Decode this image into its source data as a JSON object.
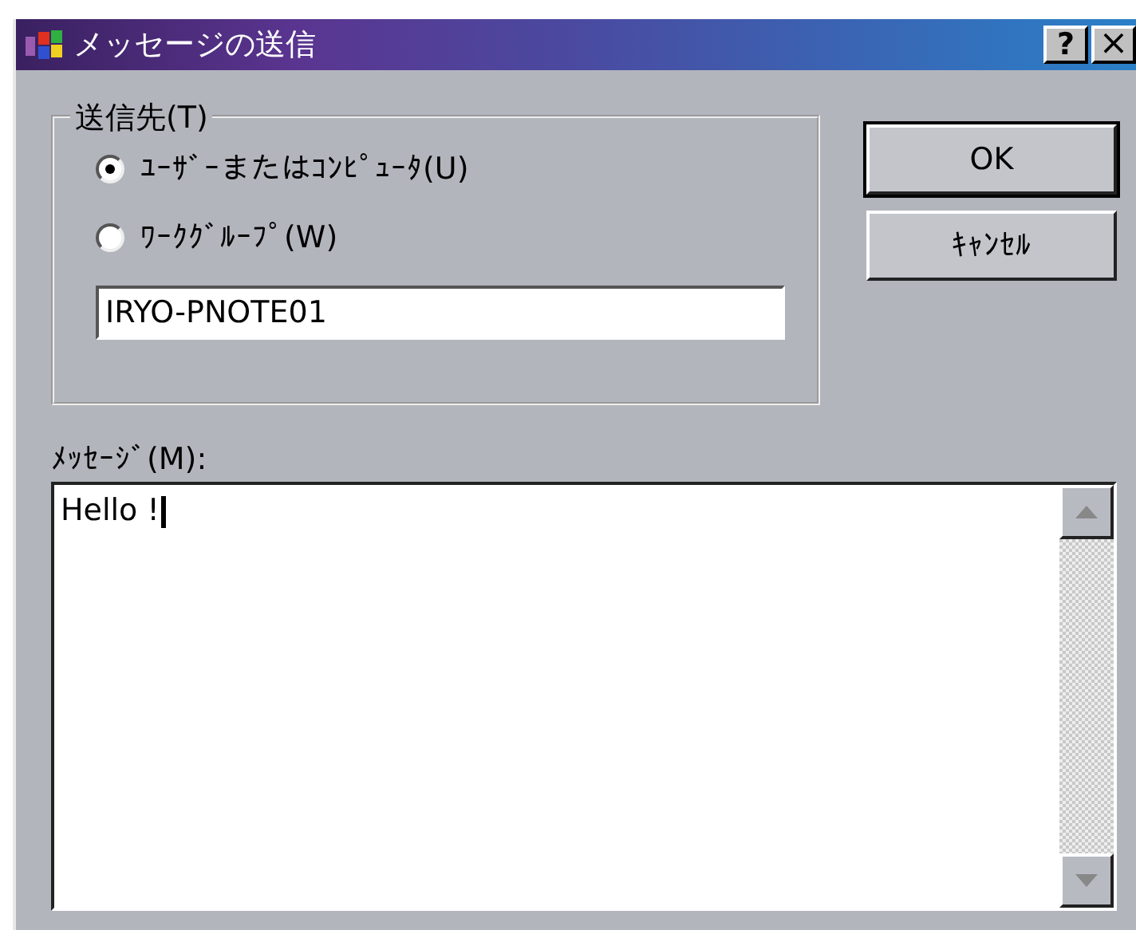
{
  "window": {
    "title": "メッセージの送信",
    "buttons": [
      {
        "kind": "help",
        "label": "?"
      },
      {
        "kind": "close",
        "label": "×"
      }
    ]
  },
  "destination": {
    "label": "送信先(T)",
    "options": [
      {
        "label": "ﾕｰｻﾞｰまたはｺﾝﾋﾟｭｰﾀ(U)",
        "selected": true
      },
      {
        "label": "ﾜｰｸｸﾞﾙｰﾌﾟ(W)",
        "selected": false
      }
    ],
    "name_field": {
      "value": "IRYO-PNOTE01"
    }
  },
  "buttons": [
    {
      "label": "OK",
      "default": true
    },
    {
      "label": "ｷｬﾝｾﾙ",
      "default": false
    }
  ],
  "message": {
    "label": "ﾒｯｾｰｼﾞ(M):",
    "value": "Hello !"
  }
}
